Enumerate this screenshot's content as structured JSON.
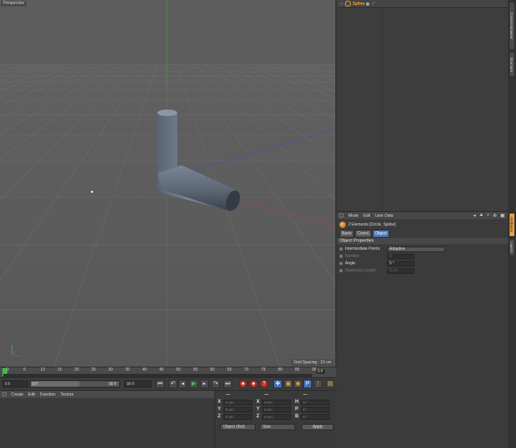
{
  "viewport": {
    "label": "Perspective",
    "grid_spacing": "Grid Spacing : 10 cm"
  },
  "timeline": {
    "ticks": [
      "0",
      "5",
      "10",
      "15",
      "20",
      "25",
      "30",
      "35",
      "40",
      "45",
      "50",
      "55",
      "60",
      "65",
      "70",
      "75",
      "80",
      "85",
      "90"
    ],
    "end_frame": "0 F"
  },
  "transport": {
    "current_frame": "0 F",
    "start_field": "0 F",
    "range_end_field": "90 F",
    "end_field": "90 F"
  },
  "materials": {
    "menu": [
      "Create",
      "Edit",
      "Function",
      "Texture"
    ]
  },
  "coords": {
    "header": [
      "—",
      "—",
      "—"
    ],
    "rows": [
      {
        "axis": "X",
        "pos": "0 cm",
        "axis2": "X",
        "size": "0 cm",
        "rot_axis": "H",
        "rot": "0 °"
      },
      {
        "axis": "Y",
        "pos": "0 cm",
        "axis2": "Y",
        "size": "0 cm",
        "rot_axis": "P",
        "rot": "0 °"
      },
      {
        "axis": "Z",
        "pos": "0 cm",
        "axis2": "Z",
        "size": "0 cm",
        "rot_axis": "B",
        "rot": "0 °"
      }
    ],
    "mode_dropdown": "Object (Rel)",
    "size_dropdown": "Size",
    "apply_label": "Apply"
  },
  "object_manager": {
    "object_name": "Spline"
  },
  "side_tabs": [
    "Content Browser",
    "Structure",
    "Attributes",
    "Layers"
  ],
  "attributes": {
    "menu": [
      "Mode",
      "Edit",
      "User Data"
    ],
    "element_title": "2 Elements [Circle, Spline]",
    "tabs": [
      "Basic",
      "Coord.",
      "Object"
    ],
    "section_title": "Object Properties",
    "properties": [
      {
        "label": "Intermediate Points",
        "value": "Adaptive",
        "enabled": true,
        "kind": "drop"
      },
      {
        "label": "Number",
        "value": "8",
        "enabled": false,
        "kind": "field"
      },
      {
        "label": "Angle",
        "value": "5 °",
        "enabled": true,
        "kind": "field"
      },
      {
        "label": "Maximum Length",
        "value": "5 cm",
        "enabled": false,
        "kind": "field"
      }
    ]
  },
  "colors": {
    "accent_orange": "#e7a23c",
    "active_tab_blue": "#4f7bbd",
    "play_green": "#49c24f",
    "record_red": "#b83028"
  }
}
